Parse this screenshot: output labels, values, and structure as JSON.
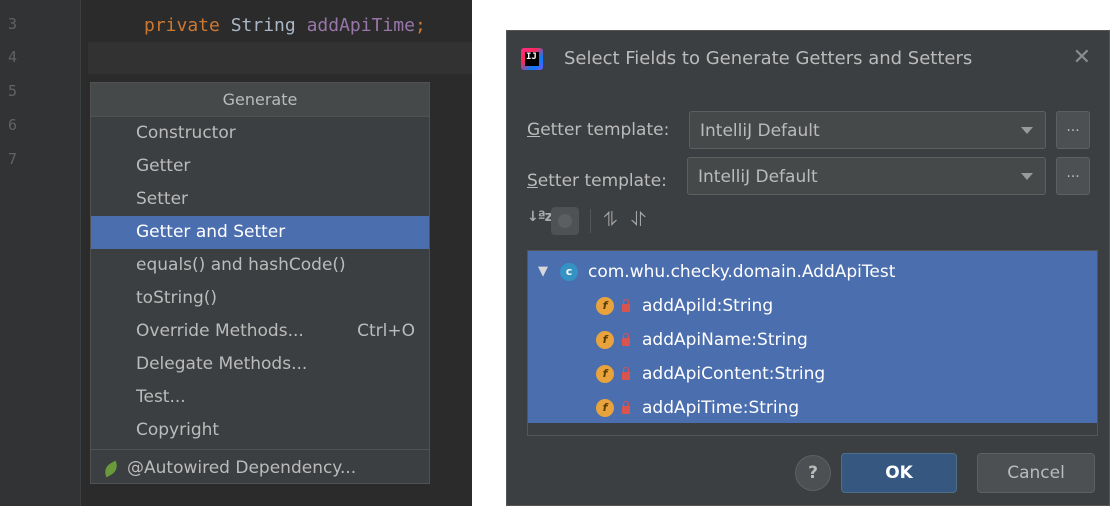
{
  "editor": {
    "line_numbers": [
      "3",
      "4",
      "5",
      "6",
      "7"
    ],
    "code": {
      "keyword": "private",
      "type": "String",
      "field": "addApiTime",
      "punct": ";"
    }
  },
  "generate_popup": {
    "title": "Generate",
    "items": [
      {
        "label": "Constructor",
        "shortcut": ""
      },
      {
        "label": "Getter",
        "shortcut": ""
      },
      {
        "label": "Setter",
        "shortcut": ""
      },
      {
        "label": "Getter and Setter",
        "shortcut": "",
        "selected": true
      },
      {
        "label": "equals() and hashCode()",
        "shortcut": ""
      },
      {
        "label": "toString()",
        "shortcut": ""
      },
      {
        "label": "Override Methods...",
        "shortcut": "Ctrl+O"
      },
      {
        "label": "Delegate Methods...",
        "shortcut": ""
      },
      {
        "label": "Test...",
        "shortcut": ""
      },
      {
        "label": "Copyright",
        "shortcut": ""
      }
    ],
    "plugin_item": {
      "label": "@Autowired Dependency...",
      "icon": "leaf-icon"
    }
  },
  "dialog": {
    "title": "Select Fields to Generate Getters and Setters",
    "close_glyph": "✕",
    "getter": {
      "mnemonic": "G",
      "label_rest": "etter template:",
      "value": "IntelliJ Default"
    },
    "setter": {
      "mnemonic": "S",
      "label_rest": "etter template:",
      "value": "IntelliJ Default"
    },
    "dots_label": "...",
    "toolbar": {
      "sort_glyph": "↓ªz",
      "expand_glyph": "⥮",
      "collapse_glyph": "⥯"
    },
    "tree": {
      "class_name": "com.whu.checky.domain.AddApiTest",
      "class_icon_letter": "c",
      "fields": [
        {
          "label": "addApild:String"
        },
        {
          "label": "addApiName:String"
        },
        {
          "label": "addApiContent:String"
        },
        {
          "label": "addApiTime:String"
        }
      ],
      "field_icon_letter": "f"
    },
    "help_label": "?",
    "ok_label": "OK",
    "cancel_label": "Cancel"
  },
  "colors": {
    "selection": "#4b6eaf",
    "panel": "#3c3f41",
    "editor_bg": "#2b2b2b",
    "ok_button": "#365880"
  }
}
